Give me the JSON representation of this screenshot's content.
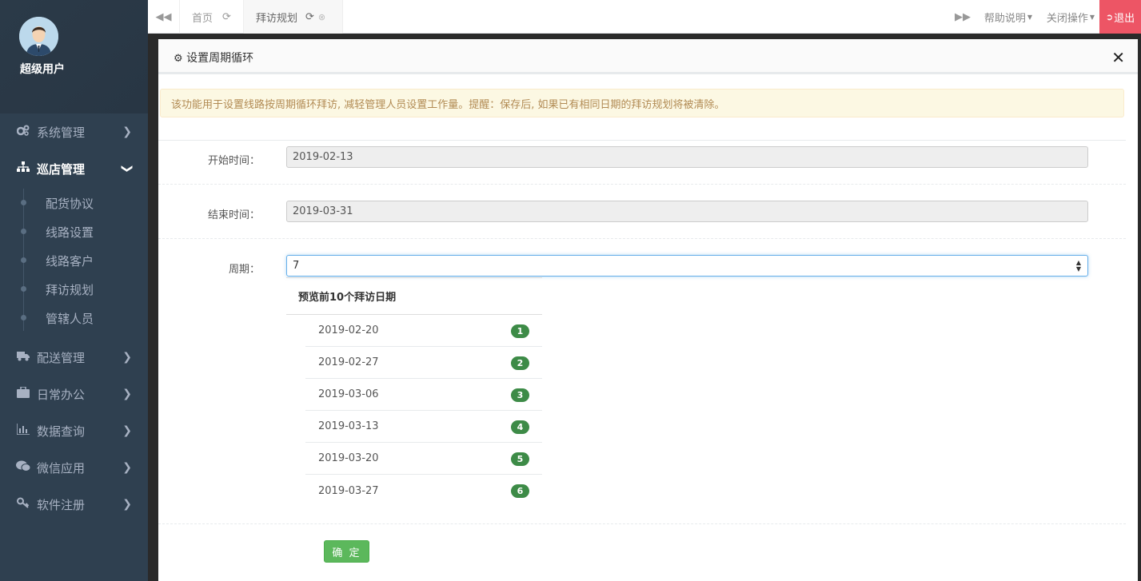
{
  "user": {
    "name": "超级用户"
  },
  "sidebar": {
    "items": [
      {
        "label": "系统管理",
        "icon": "gears-icon"
      },
      {
        "label": "巡店管理",
        "icon": "sitemap-icon",
        "expanded": true
      },
      {
        "label": "配送管理",
        "icon": "truck-icon"
      },
      {
        "label": "日常办公",
        "icon": "briefcase-icon"
      },
      {
        "label": "数据查询",
        "icon": "bar-chart-icon"
      },
      {
        "label": "微信应用",
        "icon": "wechat-icon"
      },
      {
        "label": "软件注册",
        "icon": "key-icon"
      }
    ],
    "subitems": [
      "配货协议",
      "线路设置",
      "线路客户",
      "拜访规划",
      "管辖人员"
    ]
  },
  "topbar": {
    "tabs": [
      {
        "label": "首页"
      },
      {
        "label": "拜访规划"
      }
    ],
    "help": "帮助说明",
    "close_ops": "关闭操作",
    "logout": "退出"
  },
  "modal": {
    "title": "设置周期循环",
    "alert": "该功能用于设置线路按周期循环拜访, 减轻管理人员设置工作量。提醒：保存后, 如果已有相同日期的拜访规划将被清除。",
    "start_label": "开始时间：",
    "start_value": "2019-02-13",
    "end_label": "结束时间：",
    "end_value": "2019-03-31",
    "period_label": "周期：",
    "period_value": "7",
    "preview_title": "预览前10个拜访日期",
    "preview": [
      {
        "date": "2019-02-20",
        "n": "1"
      },
      {
        "date": "2019-02-27",
        "n": "2"
      },
      {
        "date": "2019-03-06",
        "n": "3"
      },
      {
        "date": "2019-03-13",
        "n": "4"
      },
      {
        "date": "2019-03-20",
        "n": "5"
      },
      {
        "date": "2019-03-27",
        "n": "6"
      }
    ],
    "confirm": "确 定"
  },
  "colors": {
    "sidebar": "#2f4050",
    "logout": "#ed5565",
    "badge": "#3d8b47",
    "confirm": "#5cb85c"
  }
}
